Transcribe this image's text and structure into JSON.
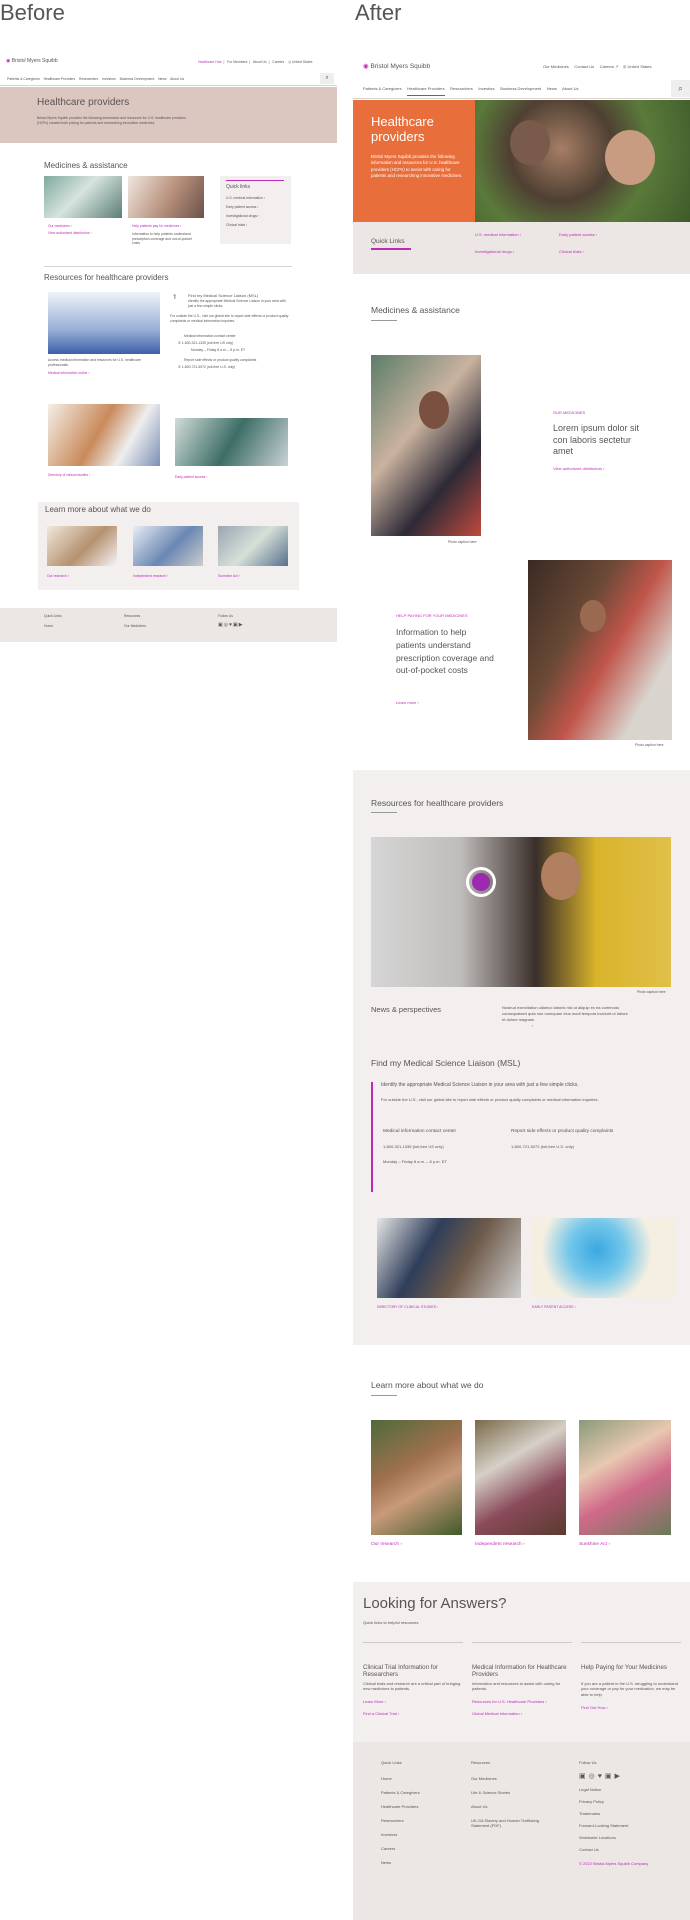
{
  "labels": {
    "before": "Before",
    "after": "After"
  },
  "colors": {
    "magenta": "#be2bbb",
    "orange": "#e86f3b",
    "hero_bg": "#dcc6c0",
    "footer_bg": "#ece6e4",
    "section_bg": "#f2efee"
  },
  "before": {
    "logo": "Bristol Myers Squibb",
    "utility": [
      "Healthcare Hub",
      "For Members",
      "About Us",
      "Careers",
      "United States"
    ],
    "nav": [
      "Patients & Caregivers",
      "Healthcare Providers",
      "Researchers",
      "Investors",
      "Business Development",
      "News",
      "About Us"
    ],
    "hero_title": "Healthcare providers",
    "hero_text": "Bristol Myers Squibb provides the following information and resources for U.S. healthcare providers (HCPs) created both pricing for patients and researching innovative medicines.",
    "meds_title": "Medicines & assistance",
    "meds_links": [
      "Our medicines ›",
      "View authorized distributors ›",
      "Help patients pay for medicines ›"
    ],
    "meds_help_text": "Information to help patients understand prescription coverage and out-of-pocket costs",
    "quick_title": "Quick links",
    "quick_links": [
      "U.S. medical information ›",
      "Early patient access ›",
      "Investigational drugs ›",
      "Clinical trials ›"
    ],
    "resources_title": "Resources for healthcare providers",
    "msl_title": "Find my Medical Science Liaison (MSL)",
    "msl_text": "Identify the appropriate Medical Science Liaison in your area with just a few simple clicks.",
    "msl_outside": "For outside the U.S., visit our global site to report side effects or product quality complaints or medical information inquiries.",
    "contact_title": "Medical information contact center",
    "contact_phone": "1-800-321-1335 (toll-free US only)",
    "contact_hours": "Monday – Friday 8 a.m. – 8 p.m. ET",
    "report_title": "Report side effects or product quality complaints",
    "report_phone": "1-800-721-5072 (toll-free U.S. only)",
    "resources_caption": "Access medical information and resources for U.S. healthcare professionals.",
    "resources_link": "Medical information online ›",
    "directory_link": "Directory of clinical studies ›",
    "early_link": "Early patient access ›",
    "learn_title": "Learn more about what we do",
    "learn_links": [
      "Our research ›",
      "Independent research ›",
      "Sunshine Act ›"
    ],
    "footer_cols": [
      "Quick Links",
      "Resources",
      "Follow Us"
    ],
    "footer_items": [
      "Home",
      "Our Medicines"
    ]
  },
  "after": {
    "logo": "Bristol Myers Squibb",
    "utility": [
      "Our Medicines",
      "Contact Us",
      "Careers",
      "United States"
    ],
    "nav": [
      "Patients & Caregivers",
      "Healthcare Providers",
      "Researchers",
      "Investors",
      "Business Development",
      "News",
      "About Us"
    ],
    "hero_title": "Healthcare providers",
    "hero_text": "Bristol Myers Squibb provides the following information and resources for U.S. healthcare providers (HCPs) to assist with caring for patients and researching innovative medicines.",
    "quick_title": "Quick Links",
    "quick_links": [
      "U.S. medical information ›",
      "Early patient access ›",
      "Investigational drugs ›",
      "Clinical trials ›"
    ],
    "meds_title": "Medicines & assistance",
    "med1_eyebrow": "OUR MEDICINES",
    "med1_title": "Lorem ipsum dolor sit con laboris sectetur amet",
    "med1_link": "View authorized distributors ›",
    "caption": "Photo caption here",
    "med2_eyebrow": "HELP PAYING FOR YOUR MEDICINES",
    "med2_title": "Information to help patients understand prescription coverage and out-of-pocket costs",
    "med2_link": "Learn more ›",
    "resources_title": "Resources for healthcare providers",
    "news_title": "News & perspectives",
    "news_text": "Nostrud exercitation ullamco laboris nisi ut aliquip ex ea commodo consequatsed quia non numquam eius modi tempora incidunt ut labore et dolore magnam",
    "news_link": "›",
    "msl_title": "Find my Medical Science Liaison (MSL)",
    "msl_text": "Identify the appropriate Medical Science Liaison in your area with just a few simple clicks.",
    "msl_outside": "For outside the U.S., visit our global site to report side effects or product quality complaints or medical information inquiries.",
    "contact_title": "Medical information contact center",
    "contact_phone": "1-800-321-1335 (toll-free US only)",
    "contact_hours": "Monday – Friday 8 a.m. – 8 p.m. ET",
    "report_title": "Report side effects or product quality complaints",
    "report_phone": "1-800-721-5072 (toll-free U.S. only)",
    "directory_link": "DIRECTORY OF CLINICAL STUDIES ›",
    "early_link": "EARLY PATIENT ACCESS ›",
    "learn_title": "Learn more about what we do",
    "learn_links": [
      "Our research ›",
      "Independent research ›",
      "Sunshine Act ›"
    ],
    "answers_title": "Looking for Answers?",
    "answers_sub": "Quick links to helpful resources.",
    "answers": [
      {
        "title": "Clinical Trial Information for Researchers",
        "text": "Clinical trials and research are a critical part of bringing new medicines to patients.",
        "links": [
          "Learn More ›",
          "Find a Clinical Trial ›"
        ]
      },
      {
        "title": "Medical Information for Healthcare Providers",
        "text": "Information and resources to assist with caring for patients.",
        "links": [
          "Resources for U.S. Healthcare Providers ›",
          "Global Medical Information ›"
        ]
      },
      {
        "title": "Help Paying for Your Medicines",
        "text": "If you are a patient in the U.S. struggling to understand your coverage or pay for your medication, we may be able to help.",
        "links": [
          "Find Out How ›"
        ]
      }
    ],
    "footer_quick_title": "Quick Links",
    "footer_quick": [
      "Home",
      "Patients & Caregivers",
      "Healthcare Providers",
      "Researchers",
      "Investors",
      "Careers",
      "News"
    ],
    "footer_res_title": "Resources",
    "footer_res": [
      "Our Medicines",
      "Life & Science Stories",
      "About Us",
      "UK-GA Slavery and Human Trafficking Statement (PDF)"
    ],
    "footer_follow_title": "Follow Us",
    "footer_follow": [
      "Legal Notice",
      "Privacy Policy",
      "Trademarks",
      "Forward-Looking Statement",
      "Worldwide Locations",
      "Contact Us"
    ],
    "copyright": "© 2022 Bristol-Myers Squibb Company"
  }
}
